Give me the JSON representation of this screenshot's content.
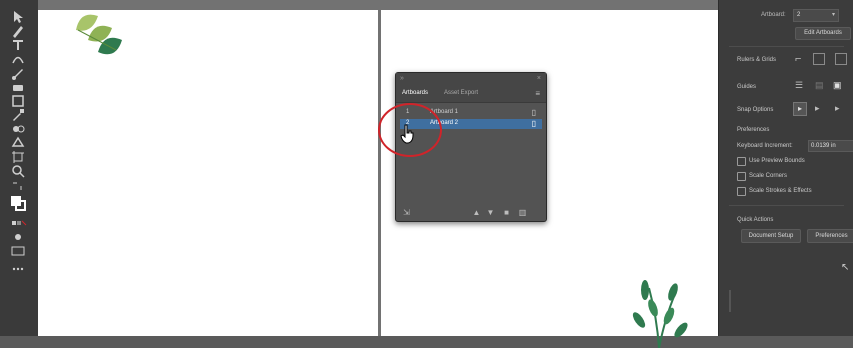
{
  "panel": {
    "tabs": [
      {
        "label": "Artboards"
      },
      {
        "label": "Asset Export"
      }
    ],
    "artboards": [
      {
        "number": "1",
        "name": "Artboard 1"
      },
      {
        "number": "2",
        "name": "Artboard 2"
      }
    ]
  },
  "properties": {
    "artboard_label": "Artboard:",
    "artboard_value": "2",
    "edit_artboards_button": "Edit Artboards",
    "rulers_grids_label": "Rulers & Grids",
    "guides_label": "Guides",
    "snap_options_label": "Snap Options",
    "preferences_heading": "Preferences",
    "keyboard_increment_label": "Keyboard Increment:",
    "keyboard_increment_value": "0.0139 in",
    "use_preview_bounds": "Use Preview Bounds",
    "scale_corners": "Scale Corners",
    "scale_strokes_effects": "Scale Strokes & Effects",
    "quick_actions_heading": "Quick Actions",
    "document_setup_button": "Document Setup",
    "preferences_button": "Preferences"
  },
  "colors": {
    "selection": "#3f6fa0",
    "highlight_circle": "#d0242a",
    "leaf_light": "#a8c46a",
    "leaf_dark": "#2f7a4f"
  }
}
